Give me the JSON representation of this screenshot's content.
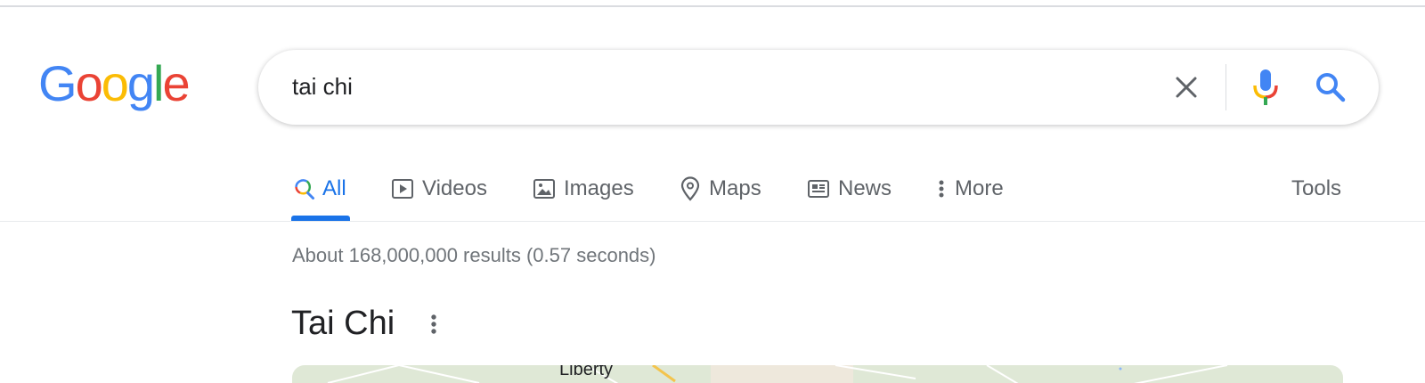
{
  "logo": {
    "letters": [
      "G",
      "o",
      "o",
      "g",
      "l",
      "e"
    ],
    "colors": [
      "#4285F4",
      "#EA4335",
      "#FBBC05",
      "#4285F4",
      "#34A853",
      "#EA4335"
    ]
  },
  "search": {
    "query": "tai chi",
    "clear_icon": "close-icon",
    "mic_icon": "microphone-icon",
    "search_icon": "search-icon"
  },
  "tabs": [
    {
      "label": "All",
      "icon": "search-icon",
      "active": true
    },
    {
      "label": "Videos",
      "icon": "play-icon"
    },
    {
      "label": "Images",
      "icon": "image-icon"
    },
    {
      "label": "Maps",
      "icon": "map-pin-icon"
    },
    {
      "label": "News",
      "icon": "newspaper-icon"
    },
    {
      "label": "More",
      "icon": "vertical-dots-icon"
    }
  ],
  "tools": {
    "label": "Tools"
  },
  "results": {
    "stats": "About 168,000,000 results (0.57 seconds)"
  },
  "knowledge_panel": {
    "title": "Tai Chi",
    "menu_icon": "vertical-dots-icon",
    "map_label": "Liberty"
  },
  "colors": {
    "accent": "#1a73e8",
    "text": "#202124",
    "muted": "#5f6368",
    "stats": "#70757a"
  }
}
